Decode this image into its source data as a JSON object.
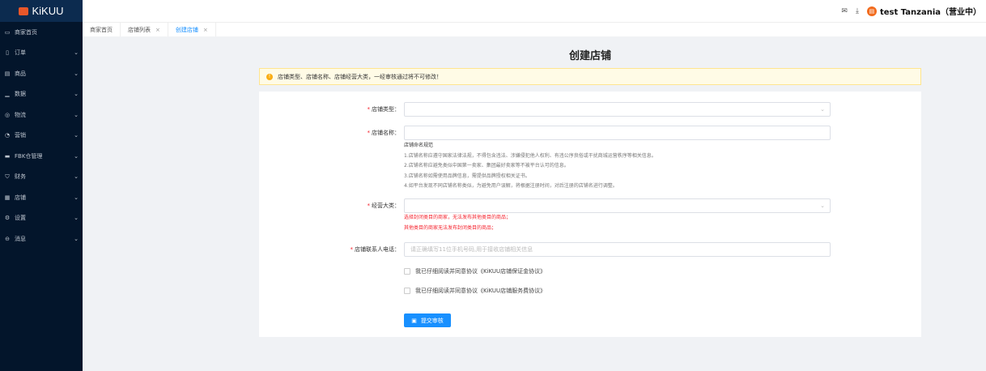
{
  "app": {
    "logo": "KiKUU"
  },
  "sidebar": {
    "items": [
      {
        "label": "商家首页",
        "icon": "monitor-icon",
        "chev": false
      },
      {
        "label": "订单",
        "icon": "order-icon",
        "chev": true
      },
      {
        "label": "商品",
        "icon": "product-icon",
        "chev": true
      },
      {
        "label": "数据",
        "icon": "chart-icon",
        "chev": true
      },
      {
        "label": "物流",
        "icon": "logistics-icon",
        "chev": true
      },
      {
        "label": "营销",
        "icon": "pie-icon",
        "chev": true
      },
      {
        "label": "FBK仓管理",
        "icon": "warehouse-icon",
        "chev": true
      },
      {
        "label": "财务",
        "icon": "shield-icon",
        "chev": true
      },
      {
        "label": "店铺",
        "icon": "store-icon",
        "chev": true
      },
      {
        "label": "设置",
        "icon": "gear-icon",
        "chev": true
      },
      {
        "label": "消息",
        "icon": "message-icon",
        "chev": true
      }
    ]
  },
  "header": {
    "user": "test Tanzania（营业中）"
  },
  "tabs": [
    {
      "label": "商家首页"
    },
    {
      "label": "店铺列表"
    },
    {
      "label": "创建店铺"
    }
  ],
  "page": {
    "title": "创建店铺",
    "warning": "店铺类型、店铺名称、店铺经营大类，一经审核通过将不可修改！",
    "fields": {
      "type_label": "店铺类型：",
      "name_label": "店铺名称：",
      "category_label": "经营大类：",
      "phone_label": "店铺联系人电话：",
      "phone_placeholder": "请正确填写11位手机号码,用于接收店铺相关信息"
    },
    "rules_title": "店铺命名规范",
    "rules": [
      "1.店铺名称应遵守国家法律法规，不得包含违法、涉嫌侵犯他人权利、有违公序良俗或干扰商城运营秩序等相关信息。",
      "2.店铺名称应避免类似中国第一卖家、集团最好卖家等不被平台认可的信息。",
      "3.店铺名称如需使用品牌信息，需提供品牌授权相关证书。",
      "4.如平台发现不同店铺名称类似，为避免用户误解，将根据注册时间，对后注册的店铺名进行调整。"
    ],
    "category_notes": [
      "选择封闭类目的商家，无法发布其他类目的商品；",
      "其他类目的商家无法发布封闭类目的商品；"
    ],
    "agree1": "我已仔细阅读并同意协议《KiKUU店铺保证金协议》",
    "agree2": "我已仔细阅读并同意协议《KiKUU店铺服务费协议》",
    "submit": "提交审核"
  }
}
